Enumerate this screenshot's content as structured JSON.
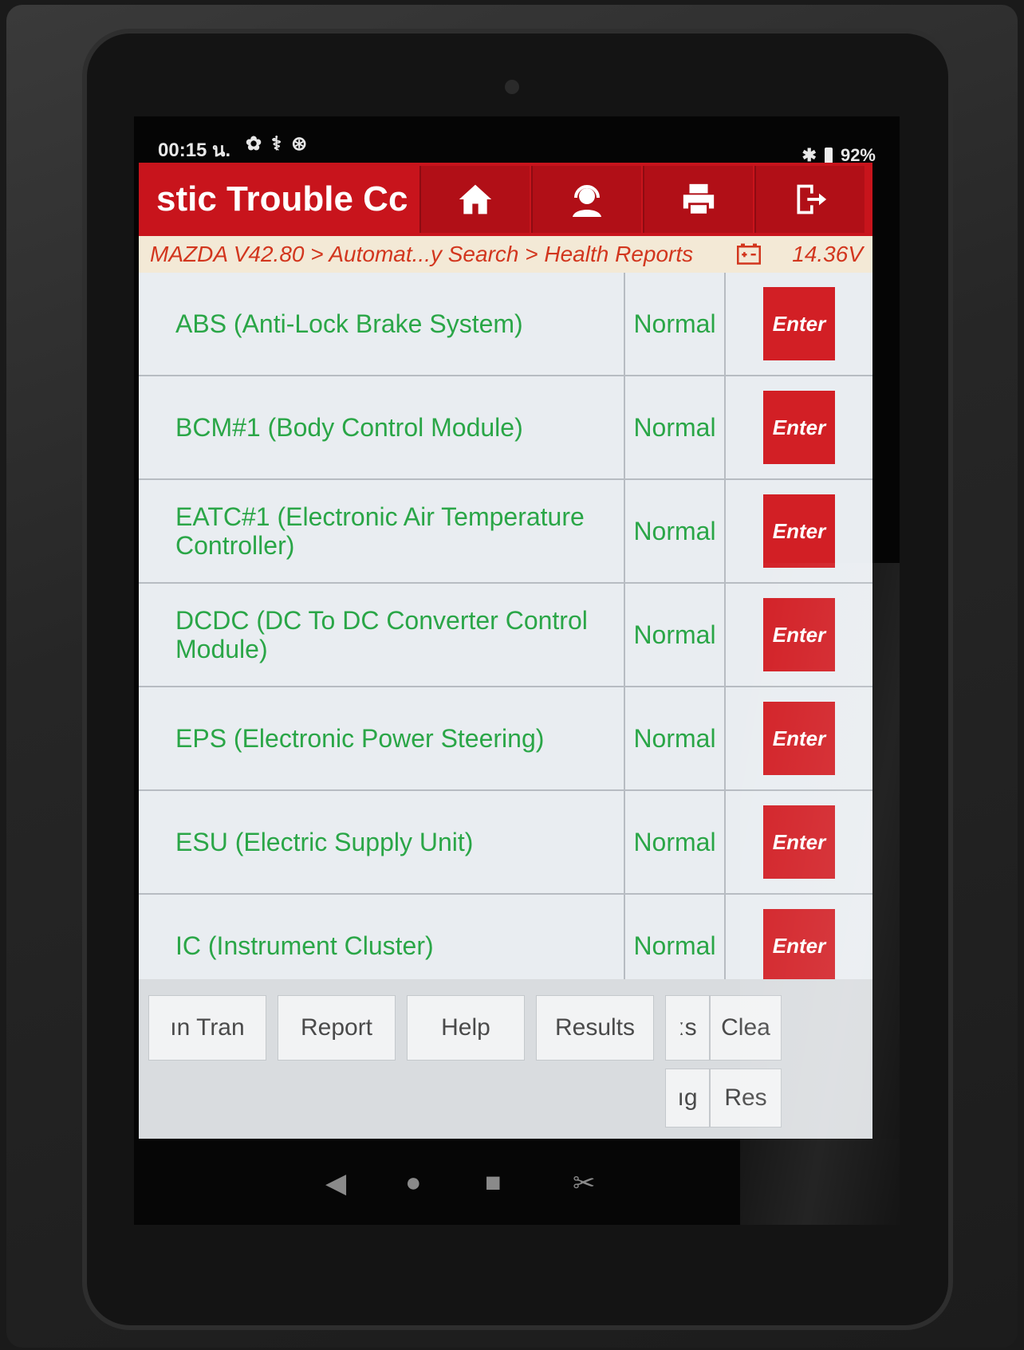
{
  "status_bar": {
    "time": "00:15 น.",
    "icons": [
      "gear-icon",
      "stethoscope-icon",
      "accessibility-icon"
    ],
    "battery": "92%"
  },
  "header": {
    "title": "stic Trouble Cc",
    "buttons": [
      "home-icon",
      "support-icon",
      "print-icon",
      "exit-icon"
    ]
  },
  "breadcrumb": {
    "path": "MAZDA V42.80 > Automat...y Search > Health Reports",
    "voltage": "14.36V"
  },
  "modules": [
    {
      "name": "ABS (Anti-Lock Brake System)",
      "status": "Normal",
      "action": "Enter"
    },
    {
      "name": "BCM#1 (Body Control Module)",
      "status": "Normal",
      "action": "Enter"
    },
    {
      "name": "EATC#1 (Electronic Air Temperature Controller)",
      "status": "Normal",
      "action": "Enter"
    },
    {
      "name": "DCDC (DC To DC Converter Control Module)",
      "status": "Normal",
      "action": "Enter"
    },
    {
      "name": "EPS (Electronic Power Steering)",
      "status": "Normal",
      "action": "Enter"
    },
    {
      "name": "ESU (Electric Supply Unit)",
      "status": "Normal",
      "action": "Enter"
    },
    {
      "name": "IC (Instrument Cluster)",
      "status": "Normal",
      "action": "Enter"
    }
  ],
  "toolbar": {
    "row1": [
      "ın    Tran",
      "Report",
      "Help",
      "Results",
      "ːs",
      "Clea"
    ],
    "row2": [
      "ıg",
      "Res"
    ]
  },
  "colors": {
    "accent": "#c8141c",
    "status_green": "#2aa647",
    "crumb_text": "#d2361e"
  }
}
